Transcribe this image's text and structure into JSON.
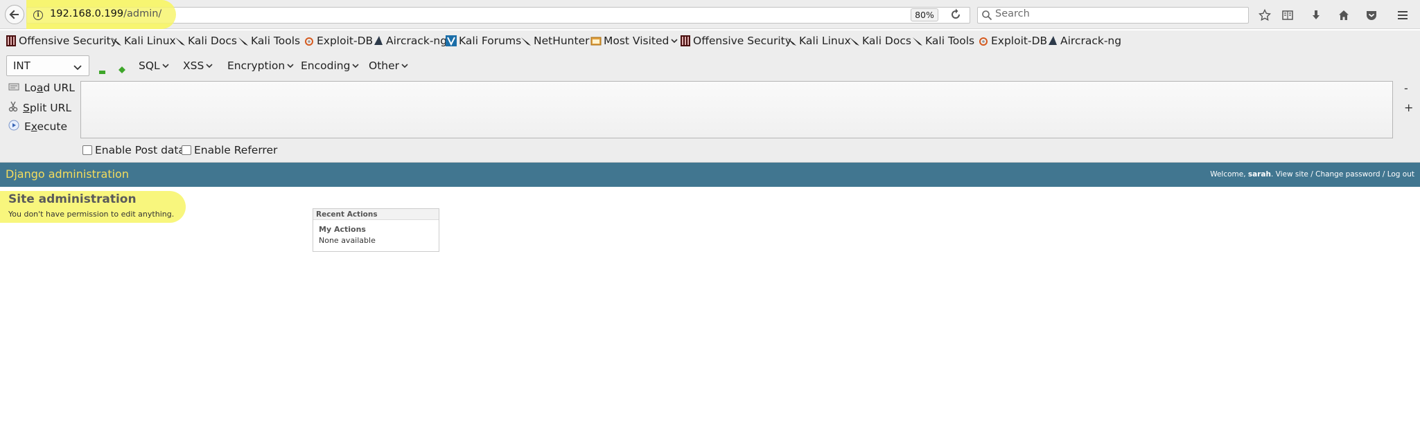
{
  "browser": {
    "url_host": "192.168.0.199",
    "url_path": "/admin/",
    "zoom": "80%",
    "search_placeholder": "Search"
  },
  "bookmarks": [
    {
      "label": "Offensive Security",
      "icon": "offsec-icon"
    },
    {
      "label": "Kali Linux",
      "icon": "kali-dragon-icon"
    },
    {
      "label": "Kali Docs",
      "icon": "kali-dragon-icon"
    },
    {
      "label": "Kali Tools",
      "icon": "kali-dragon-icon"
    },
    {
      "label": "Exploit-DB",
      "icon": "exploitdb-icon"
    },
    {
      "label": "Aircrack-ng",
      "icon": "aircrack-icon"
    },
    {
      "label": "Kali Forums",
      "icon": "kali-forums-icon"
    },
    {
      "label": "NetHunter",
      "icon": "kali-dragon-icon"
    },
    {
      "label": "Most Visited",
      "icon": "folder-icon"
    },
    {
      "label": "Offensive Security",
      "icon": "offsec-icon"
    },
    {
      "label": "Kali Linux",
      "icon": "kali-dragon-icon"
    },
    {
      "label": "Kali Docs",
      "icon": "kali-dragon-icon"
    },
    {
      "label": "Kali Tools",
      "icon": "kali-dragon-icon"
    },
    {
      "label": "Exploit-DB",
      "icon": "exploitdb-icon"
    },
    {
      "label": "Aircrack-ng",
      "icon": "aircrack-icon"
    }
  ],
  "hackbar": {
    "type_select": "INT",
    "menus": [
      "SQL",
      "XSS",
      "Encryption",
      "Encoding",
      "Other"
    ],
    "load_url": {
      "pre": "Lo",
      "accel": "a",
      "post": "d URL"
    },
    "split_url": {
      "pre": "",
      "accel": "S",
      "post": "plit URL"
    },
    "execute": {
      "pre": "E",
      "accel": "x",
      "post": "ecute"
    },
    "minus": "-",
    "plus": "+",
    "enable_post": "Enable Post data",
    "enable_referrer": "Enable Referrer"
  },
  "django": {
    "brand": "Django administration",
    "welcome": "Welcome,",
    "user": "sarah",
    "links_tail": ". View site / Change password / Log out",
    "site_title": "Site administration",
    "permission_msg": "You don't have permission to edit anything.",
    "recent_actions": "Recent Actions",
    "my_actions": "My Actions",
    "none_available": "None available"
  },
  "colors": {
    "django_header": "#417690",
    "django_brand": "#f5dd5d",
    "highlight": "#f7f56f",
    "chrome": "#ededed"
  }
}
